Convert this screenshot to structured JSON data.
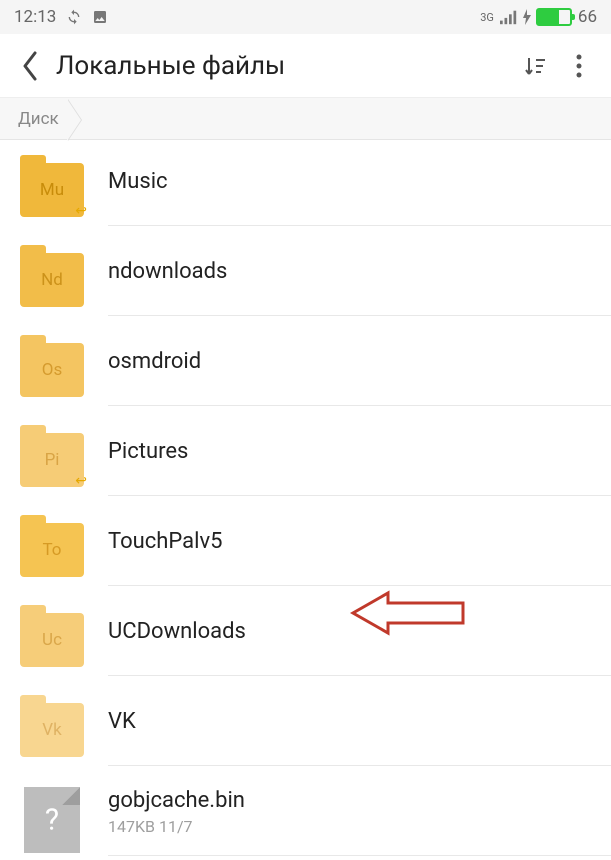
{
  "status": {
    "time": "12:13",
    "network_type": "3G",
    "battery_percent": "66"
  },
  "header": {
    "title": "Локальные файлы"
  },
  "breadcrumb": {
    "root": "Диск"
  },
  "files": [
    {
      "abbr": "Mu",
      "name": "Music",
      "type": "folder",
      "shade": "mu",
      "shortcut": true
    },
    {
      "abbr": "Nd",
      "name": "ndownloads",
      "type": "folder",
      "shade": "nd",
      "shortcut": false
    },
    {
      "abbr": "Os",
      "name": "osmdroid",
      "type": "folder",
      "shade": "os",
      "shortcut": false
    },
    {
      "abbr": "Pi",
      "name": "Pictures",
      "type": "folder",
      "shade": "pi",
      "shortcut": true
    },
    {
      "abbr": "To",
      "name": "TouchPalv5",
      "type": "folder",
      "shade": "to",
      "shortcut": false
    },
    {
      "abbr": "Uc",
      "name": "UCDownloads",
      "type": "folder",
      "shade": "uc",
      "shortcut": false
    },
    {
      "abbr": "Vk",
      "name": "VK",
      "type": "folder",
      "shade": "vk",
      "shortcut": false
    },
    {
      "abbr": "?",
      "name": "gobjcache.bin",
      "type": "file",
      "meta": "147KB  11/7"
    }
  ]
}
